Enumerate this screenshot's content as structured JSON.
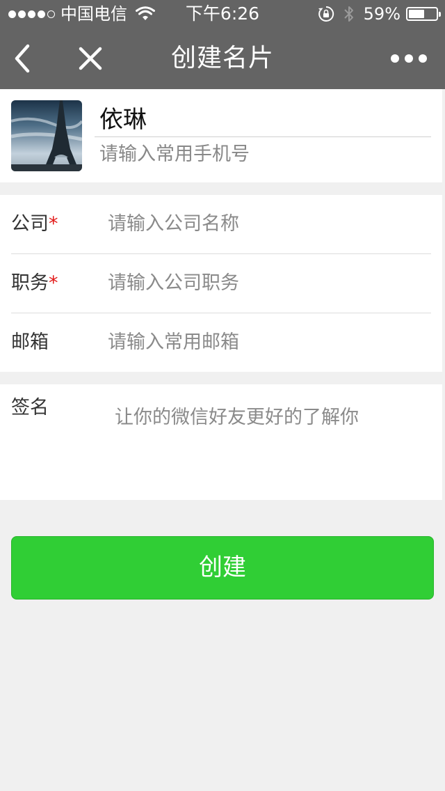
{
  "status_bar": {
    "carrier": "中国电信",
    "time": "下午6:26",
    "battery_percent": "59%",
    "battery_level": 0.59,
    "signal_bars_filled": 4,
    "signal_bars_total": 5,
    "icons": [
      "signal-dots-icon",
      "wifi-icon",
      "rotation-lock-icon",
      "bluetooth-icon",
      "battery-icon"
    ]
  },
  "nav": {
    "title": "创建名片",
    "icons": [
      "back-chevron-icon",
      "close-icon",
      "more-icon"
    ]
  },
  "profile": {
    "name": "依琳",
    "phone_placeholder": "请输入常用手机号"
  },
  "fields": [
    {
      "label": "公司",
      "required_mark": "*",
      "placeholder": "请输入公司名称"
    },
    {
      "label": "职务",
      "required_mark": "*",
      "placeholder": "请输入公司职务"
    },
    {
      "label": "邮箱",
      "required_mark": "",
      "placeholder": "请输入常用邮箱"
    }
  ],
  "signature": {
    "label": "签名",
    "placeholder": "让你的微信好友更好的了解你"
  },
  "create_button": {
    "label": "创建"
  },
  "colors": {
    "header_bg": "#646464",
    "page_bg": "#f0f0f0",
    "button_green": "#30ce35",
    "required_red": "#e21918",
    "placeholder_gray": "#8a8a8a"
  }
}
